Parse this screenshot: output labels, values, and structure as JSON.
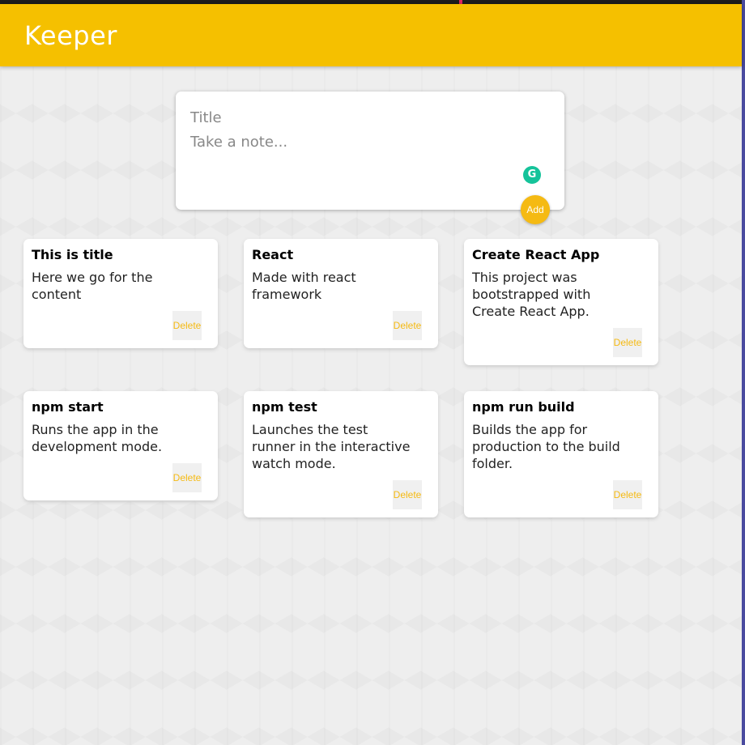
{
  "app": {
    "title": "Keeper"
  },
  "create": {
    "title_placeholder": "Title",
    "content_placeholder": "Take a note...",
    "add_label": "Add",
    "grammarly_glyph": "G"
  },
  "delete_label": "Delete",
  "notes": [
    {
      "title": "This is title",
      "content": "Here we go for the\ncontent"
    },
    {
      "title": "React",
      "content": "Made with react\nframework"
    },
    {
      "title": "Create React App",
      "content": "This project was\nbootstrapped with\nCreate React App."
    },
    {
      "title": "npm start",
      "content": "Runs the app in the\ndevelopment mode."
    },
    {
      "title": "npm test",
      "content": "Launches the test\nrunner in the interactive\nwatch mode."
    },
    {
      "title": "npm run build",
      "content": "Builds the app for\nproduction to the build\nfolder."
    }
  ],
  "colors": {
    "header": "#f5c000",
    "accent": "#f5ba13",
    "background": "#eeeeee"
  }
}
